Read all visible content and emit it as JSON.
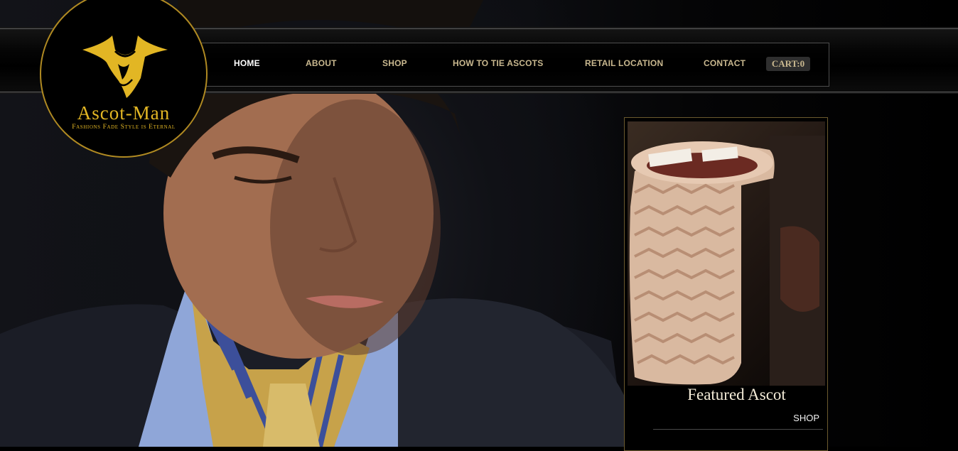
{
  "logo": {
    "name": "Ascot-Man",
    "tagline": "Fashions Fade Style is Eternal"
  },
  "nav": {
    "items": [
      {
        "label": "HOME",
        "active": true
      },
      {
        "label": "ABOUT",
        "active": false
      },
      {
        "label": "SHOP",
        "active": false
      },
      {
        "label": "HOW TO TIE ASCOTS",
        "active": false
      },
      {
        "label": "RETAIL LOCATION",
        "active": false
      },
      {
        "label": "CONTACT",
        "active": false
      }
    ],
    "cart_label": "CART:0"
  },
  "featured": {
    "title": "Featured Ascot",
    "shop_label": "SHOP"
  },
  "colors": {
    "gold": "#e2b624",
    "nav_text": "#c9b88f",
    "active_nav": "#ffffff",
    "background": "#000000"
  }
}
